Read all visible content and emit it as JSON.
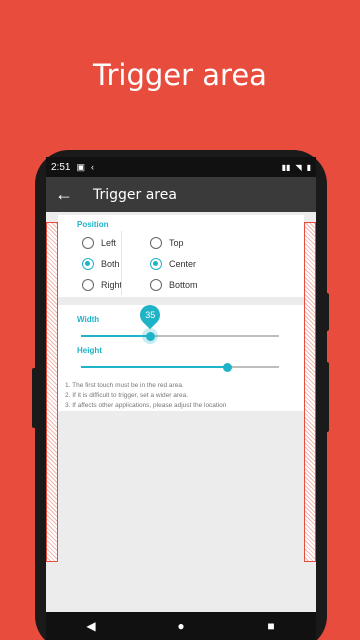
{
  "promo": {
    "title": "Trigger area"
  },
  "status_bar": {
    "time": "2:51",
    "icons": [
      "image-icon",
      "back-chevron-icon"
    ],
    "right_icons": [
      "signal-icon",
      "wifi-icon",
      "battery-icon"
    ]
  },
  "toolbar": {
    "title": "Trigger area",
    "back_icon": "arrow-left-icon"
  },
  "position": {
    "label": "Position",
    "horizontal_options": [
      {
        "label": "Left",
        "selected": false
      },
      {
        "label": "Both",
        "selected": true
      },
      {
        "label": "Right",
        "selected": false
      }
    ],
    "vertical_options": [
      {
        "label": "Top",
        "selected": false
      },
      {
        "label": "Center",
        "selected": true
      },
      {
        "label": "Bottom",
        "selected": false
      }
    ]
  },
  "width_slider": {
    "label": "Width",
    "value": "35",
    "fraction": 0.35
  },
  "height_slider": {
    "label": "Height",
    "fraction": 0.74
  },
  "notes": [
    "1. The first touch must be in the red area.",
    "2. If it is difficult to trigger, set a wider area.",
    "3. If affects other applications, please adjust the location"
  ],
  "colors": {
    "background": "#e84c3d",
    "accent": "#1fb3c7",
    "toolbar": "#3a3a3a"
  },
  "nav_bar": {
    "icons": [
      "back-triangle-icon",
      "home-circle-icon",
      "recents-square-icon"
    ]
  }
}
